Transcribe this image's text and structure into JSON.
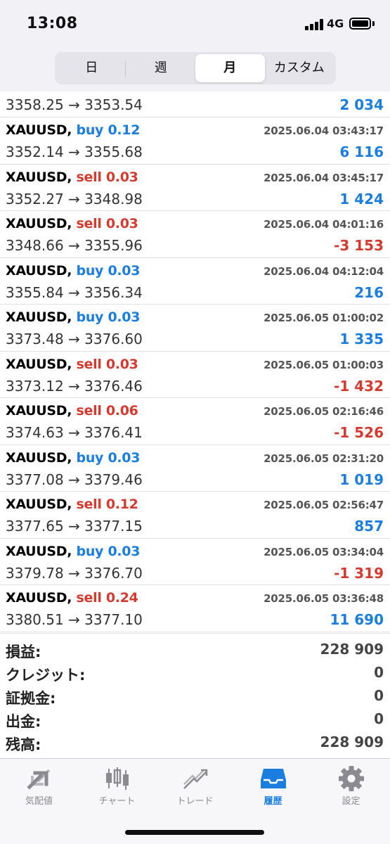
{
  "status": {
    "time": "13:08",
    "network": "4G"
  },
  "tabs": [
    "日",
    "週",
    "月",
    "カスタム"
  ],
  "active_tab": 2,
  "first_row": {
    "prices": "3358.25 → 3353.54",
    "profit": "2 034",
    "sign": "pos"
  },
  "trades": [
    {
      "symbol": "XAUUSD,",
      "side": "buy 0.12",
      "type": "buy",
      "time": "2025.06.04 03:43:17",
      "prices": "3352.14 → 3355.68",
      "profit": "6 116",
      "sign": "pos"
    },
    {
      "symbol": "XAUUSD,",
      "side": "sell 0.03",
      "type": "sell",
      "time": "2025.06.04 03:45:17",
      "prices": "3352.27 → 3348.98",
      "profit": "1 424",
      "sign": "pos"
    },
    {
      "symbol": "XAUUSD,",
      "side": "sell 0.03",
      "type": "sell",
      "time": "2025.06.04 04:01:16",
      "prices": "3348.66 → 3355.96",
      "profit": "-3 153",
      "sign": "neg"
    },
    {
      "symbol": "XAUUSD,",
      "side": "buy 0.03",
      "type": "buy",
      "time": "2025.06.04 04:12:04",
      "prices": "3355.84 → 3356.34",
      "profit": "216",
      "sign": "pos"
    },
    {
      "symbol": "XAUUSD,",
      "side": "buy 0.03",
      "type": "buy",
      "time": "2025.06.05 01:00:02",
      "prices": "3373.48 → 3376.60",
      "profit": "1 335",
      "sign": "pos"
    },
    {
      "symbol": "XAUUSD,",
      "side": "sell 0.03",
      "type": "sell",
      "time": "2025.06.05 01:00:03",
      "prices": "3373.12 → 3376.46",
      "profit": "-1 432",
      "sign": "neg"
    },
    {
      "symbol": "XAUUSD,",
      "side": "sell 0.06",
      "type": "sell",
      "time": "2025.06.05 02:16:46",
      "prices": "3374.63 → 3376.41",
      "profit": "-1 526",
      "sign": "neg"
    },
    {
      "symbol": "XAUUSD,",
      "side": "buy 0.03",
      "type": "buy",
      "time": "2025.06.05 02:31:20",
      "prices": "3377.08 → 3379.46",
      "profit": "1 019",
      "sign": "pos"
    },
    {
      "symbol": "XAUUSD,",
      "side": "sell 0.12",
      "type": "sell",
      "time": "2025.06.05 02:56:47",
      "prices": "3377.65 → 3377.15",
      "profit": "857",
      "sign": "pos"
    },
    {
      "symbol": "XAUUSD,",
      "side": "buy 0.03",
      "type": "buy",
      "time": "2025.06.05 03:34:04",
      "prices": "3379.78 → 3376.70",
      "profit": "-1 319",
      "sign": "neg"
    },
    {
      "symbol": "XAUUSD,",
      "side": "sell 0.24",
      "type": "sell",
      "time": "2025.06.05 03:36:48",
      "prices": "3380.51 → 3377.10",
      "profit": "11 690",
      "sign": "pos"
    }
  ],
  "summary": [
    {
      "label": "損益:",
      "value": "228 909"
    },
    {
      "label": "クレジット:",
      "value": "0"
    },
    {
      "label": "証拠金:",
      "value": "0"
    },
    {
      "label": "出金:",
      "value": "0"
    },
    {
      "label": "残高:",
      "value": "228 909"
    }
  ],
  "tabbar": [
    {
      "label": "気配値",
      "icon": "quotes-icon"
    },
    {
      "label": "チャート",
      "icon": "chart-icon"
    },
    {
      "label": "トレード",
      "icon": "trade-icon"
    },
    {
      "label": "履歴",
      "icon": "history-icon"
    },
    {
      "label": "設定",
      "icon": "settings-icon"
    }
  ],
  "active_tabbar": 3,
  "colors": {
    "buy": "#1a7ee0",
    "sell": "#d63a2f",
    "accent": "#1a7ee0"
  }
}
